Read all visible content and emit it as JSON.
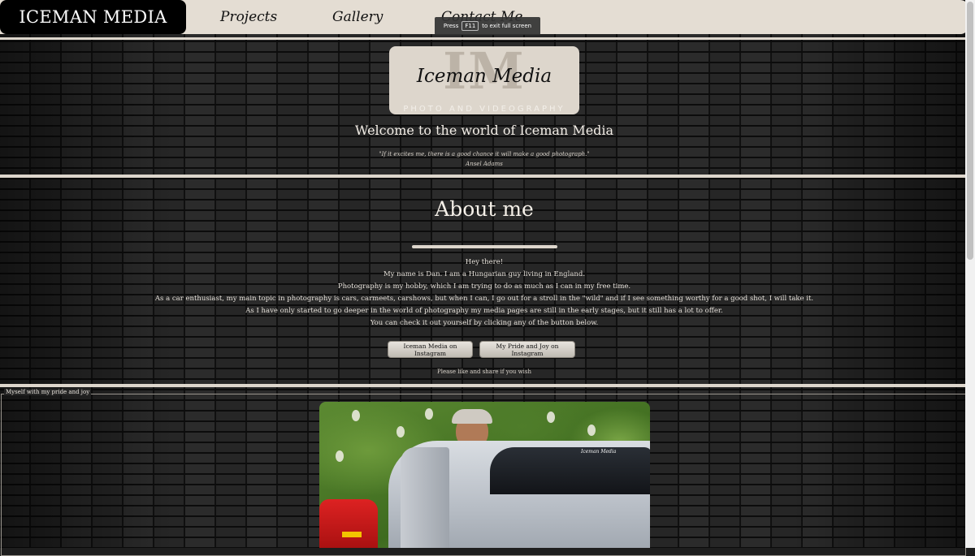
{
  "nav": {
    "brand": "ICEMAN MEDIA",
    "links": [
      "Projects",
      "Gallery",
      "Contact Me"
    ]
  },
  "fullscreen_toast": {
    "prefix": "Press",
    "key": "F11",
    "suffix": "to exit full screen"
  },
  "hero": {
    "logo_monogram": "IM",
    "logo_script": "Iceman Media",
    "logo_tagline": "PHOTO AND VIDEOGRAPHY",
    "welcome": "Welcome to the world of Iceman Media",
    "quote": "\"If it excites me, there is a good chance it will make a good photograph.\"",
    "quote_author": "Ansel Adams"
  },
  "about": {
    "title": "About me",
    "lines": [
      "Hey there!",
      "My name is Dan. I am a Hungarian guy living in England.",
      "Photography is my hobby, which I am trying to do as much as I can in my free time.",
      "As a car enthusiast, my main topic in photography is cars, carmeets, carshows, but when I can, I go out for a stroll in the \"wild\" and if I see something worthy for a good shot, I will take it.",
      "As I have only started to go deeper in the world of photography my media pages are still in the early stages, but it still has a lot to offer.",
      "You can check it out yourself by clicking any of the button below."
    ],
    "button_instagram": "Iceman Media on Instagram",
    "button_pride": "My Pride and Joy on Instagram",
    "share_note": "Please like and share if you wish"
  },
  "photo_section": {
    "legend": "Myself with my pride and joy",
    "windscreen_text": "Iceman Media"
  },
  "colors": {
    "nav_bg": "#e4ddd3",
    "brand_bg": "#000000",
    "accent_cream": "#ddd6cc"
  }
}
